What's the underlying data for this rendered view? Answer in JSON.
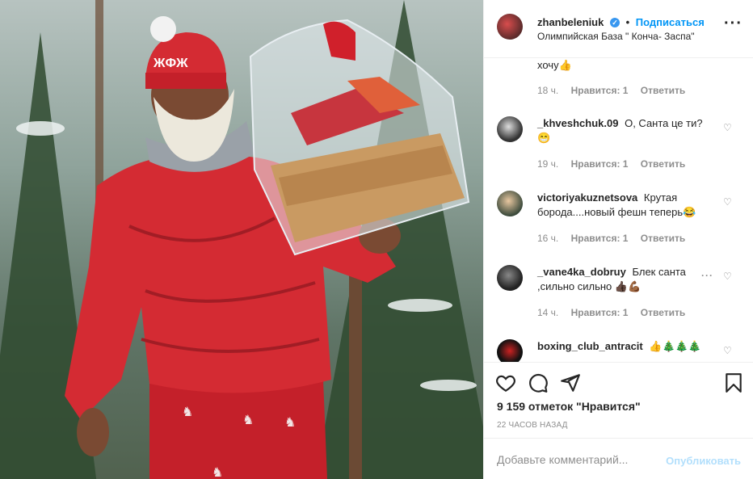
{
  "post": {
    "image_alt": "Photo",
    "author": "zhanbeleniuk",
    "follow_label": "Подписаться",
    "location": "Олимпийская База \" Конча- Заспа\"",
    "likes_text": "9 159 отметок \"Нравится\"",
    "time_text": "22 ЧАСОВ НАЗАД"
  },
  "comments": [
    {
      "user": "",
      "text": "хочу👍",
      "time": "18 ч.",
      "likes": "Нравится: 1",
      "reply": "Ответить"
    },
    {
      "user": "_khveshchuk.09",
      "text": "О, Санта це ти? 😁",
      "time": "19 ч.",
      "likes": "Нравится: 1",
      "reply": "Ответить"
    },
    {
      "user": "victoriyakuznetsova",
      "text": "Крутая борода....новый фешн теперь😂",
      "time": "16 ч.",
      "likes": "Нравится: 1",
      "reply": "Ответить"
    },
    {
      "user": "_vane4ka_dobruy",
      "text": "Блек санта ,сильно сильно 👍🏿💪🏾",
      "time": "14 ч.",
      "likes": "Нравится: 1",
      "reply": "Ответить"
    },
    {
      "user": "boxing_club_antracit",
      "text": "👍🎄🎄🎄",
      "time": "",
      "likes": "",
      "reply": ""
    }
  ],
  "add_comment": {
    "placeholder": "Добавьте комментарий...",
    "publish_label": "Опубликовать"
  },
  "icons": {
    "like": "heart-icon",
    "comment": "comment-icon",
    "share": "share-icon",
    "save": "bookmark-icon",
    "more": "more-options-icon"
  }
}
